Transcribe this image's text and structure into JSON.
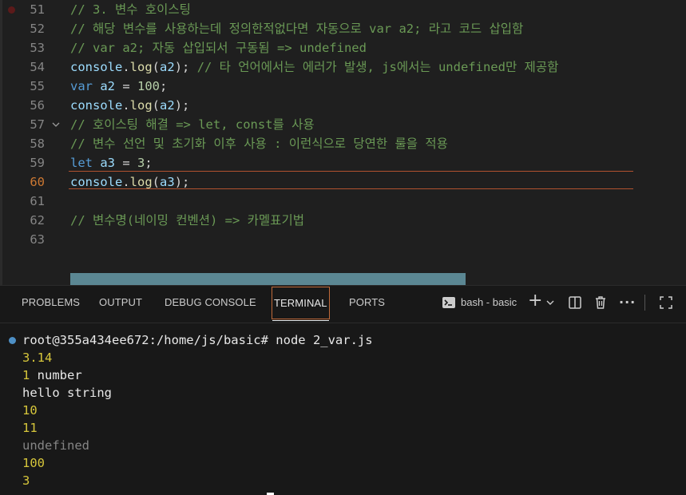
{
  "editor": {
    "lines": [
      {
        "num": "51",
        "tokens": [
          {
            "t": "// 3. 변수 호이스팅",
            "c": "comment"
          }
        ]
      },
      {
        "num": "52",
        "tokens": [
          {
            "t": "// 해당 변수를 사용하는데 정의한적없다면 자동으로 var a2; 라고 코드 삽입함",
            "c": "comment"
          }
        ]
      },
      {
        "num": "53",
        "tokens": [
          {
            "t": "// var a2; 자동 삽입되서 구동됨 => undefined",
            "c": "comment"
          }
        ]
      },
      {
        "num": "54",
        "tokens": [
          {
            "t": "console",
            "c": "obj"
          },
          {
            "t": ".",
            "c": "plain"
          },
          {
            "t": "log",
            "c": "fn"
          },
          {
            "t": "(",
            "c": "plain"
          },
          {
            "t": "a2",
            "c": "var"
          },
          {
            "t": "); ",
            "c": "plain"
          },
          {
            "t": "// 타 언어에서는 에러가 발생, js에서는 undefined만 제공함",
            "c": "comment"
          }
        ]
      },
      {
        "num": "55",
        "tokens": [
          {
            "t": "var",
            "c": "kw"
          },
          {
            "t": " ",
            "c": "plain"
          },
          {
            "t": "a2",
            "c": "var"
          },
          {
            "t": " = ",
            "c": "plain"
          },
          {
            "t": "100",
            "c": "num"
          },
          {
            "t": ";",
            "c": "plain"
          }
        ]
      },
      {
        "num": "56",
        "tokens": [
          {
            "t": "console",
            "c": "obj"
          },
          {
            "t": ".",
            "c": "plain"
          },
          {
            "t": "log",
            "c": "fn"
          },
          {
            "t": "(",
            "c": "plain"
          },
          {
            "t": "a2",
            "c": "var"
          },
          {
            "t": ");",
            "c": "plain"
          }
        ]
      },
      {
        "num": "57",
        "tokens": [
          {
            "t": "// 호이스팅 해결 => let, const를 사용",
            "c": "comment"
          }
        ]
      },
      {
        "num": "58",
        "tokens": [
          {
            "t": "// 변수 선언 및 초기화 이후 사용 : 이런식으로 당연한 룰을 적용",
            "c": "comment"
          }
        ]
      },
      {
        "num": "59",
        "tokens": [
          {
            "t": "let",
            "c": "kw"
          },
          {
            "t": " ",
            "c": "plain"
          },
          {
            "t": "a3",
            "c": "var"
          },
          {
            "t": " = ",
            "c": "plain"
          },
          {
            "t": "3",
            "c": "num"
          },
          {
            "t": ";",
            "c": "plain"
          }
        ]
      },
      {
        "num": "60",
        "tokens": [
          {
            "t": "console",
            "c": "obj"
          },
          {
            "t": ".",
            "c": "plain"
          },
          {
            "t": "log",
            "c": "fn"
          },
          {
            "t": "(",
            "c": "plain"
          },
          {
            "t": "a3",
            "c": "var"
          },
          {
            "t": ");",
            "c": "plain"
          }
        ]
      },
      {
        "num": "61",
        "tokens": []
      },
      {
        "num": "62",
        "tokens": [
          {
            "t": "// 변수명(네이밍 컨벤션) => 카멜표기법",
            "c": "comment"
          }
        ]
      },
      {
        "num": "63",
        "tokens": []
      }
    ],
    "current_line": "60",
    "folded_line": "57",
    "breakpoint_line": "51"
  },
  "panel": {
    "tabs": [
      {
        "label": "PROBLEMS",
        "active": false
      },
      {
        "label": "OUTPUT",
        "active": false
      },
      {
        "label": "DEBUG CONSOLE",
        "active": false
      },
      {
        "label": "TERMINAL",
        "active": true
      },
      {
        "label": "PORTS",
        "active": false
      }
    ],
    "terminal_name": "bash - basic",
    "icons": {
      "terminal": "terminal-icon",
      "add": "plus-icon",
      "split": "split-icon",
      "trash": "trash-icon",
      "more": "ellipsis-icon",
      "maximize": "maximize-icon"
    }
  },
  "terminal": {
    "prompt": "root@355a434ee672:/home/js/basic# node 2_var.js",
    "output": [
      {
        "text": "3.14",
        "c": "yellow"
      },
      {
        "text": "1 number",
        "c": "mixed"
      },
      {
        "text": "hello string",
        "c": "white"
      },
      {
        "text": "10",
        "c": "yellow"
      },
      {
        "text": "11",
        "c": "yellow"
      },
      {
        "text": "undefined",
        "c": "gray"
      },
      {
        "text": "100",
        "c": "yellow"
      },
      {
        "text": "3",
        "c": "yellow"
      }
    ]
  }
}
